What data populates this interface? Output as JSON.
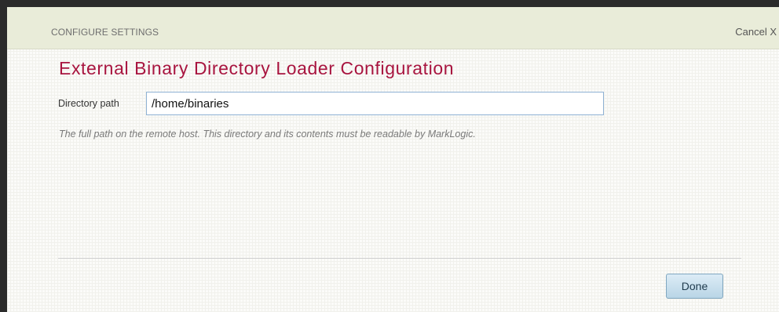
{
  "header": {
    "title": "CONFIGURE SETTINGS",
    "cancel_label": "Cancel X"
  },
  "dialog": {
    "title": "External Binary Directory Loader Configuration"
  },
  "form": {
    "directory_path": {
      "label": "Directory path",
      "value": "/home/binaries"
    },
    "help_text": "The full path on the remote host. This directory and its contents must be readable by MarkLogic."
  },
  "footer": {
    "done_label": "Done"
  },
  "colors": {
    "title": "#a8143f",
    "header_background": "#e9ecd9",
    "input_border": "#8fb2d4",
    "button_background": "#c9e0ee"
  }
}
